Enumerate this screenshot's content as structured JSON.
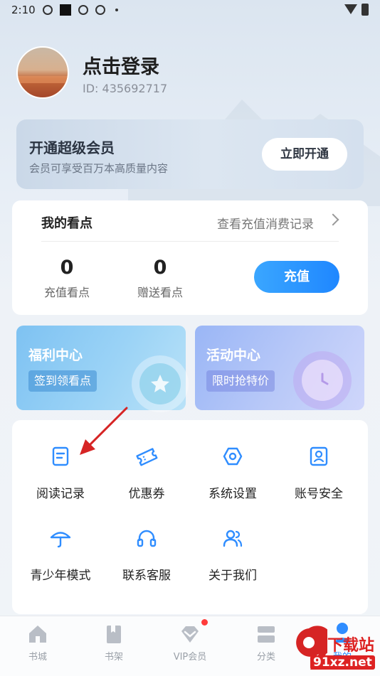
{
  "status_bar": {
    "time": "2:10"
  },
  "profile": {
    "login_text": "点击登录",
    "user_id": "ID: 435692717"
  },
  "vip_card": {
    "title": "开通超级会员",
    "subtitle": "会员可享受百万本高质量内容",
    "button": "立即开通"
  },
  "points": {
    "title": "我的看点",
    "history_link": "查看充值消费记录",
    "recharge_points": {
      "value": "0",
      "label": "充值看点"
    },
    "gift_points": {
      "value": "0",
      "label": "赠送看点"
    },
    "recharge_button": "充值"
  },
  "promos": [
    {
      "title": "福利中心",
      "pill": "签到领看点"
    },
    {
      "title": "活动中心",
      "pill": "限时抢特价"
    }
  ],
  "menu": [
    {
      "label": "阅读记录",
      "icon": "reading-record-icon"
    },
    {
      "label": "优惠券",
      "icon": "coupon-icon"
    },
    {
      "label": "系统设置",
      "icon": "settings-icon"
    },
    {
      "label": "账号安全",
      "icon": "account-security-icon"
    },
    {
      "label": "青少年模式",
      "icon": "umbrella-icon"
    },
    {
      "label": "联系客服",
      "icon": "headset-icon"
    },
    {
      "label": "关于我们",
      "icon": "users-icon"
    }
  ],
  "bottom_nav": [
    {
      "label": "书城",
      "icon": "home-icon"
    },
    {
      "label": "书架",
      "icon": "bookshelf-icon"
    },
    {
      "label": "VIP会员",
      "icon": "diamond-icon"
    },
    {
      "label": "分类",
      "icon": "category-icon"
    },
    {
      "label": "我的",
      "icon": "profile-icon"
    }
  ],
  "watermark": {
    "text": "下载站",
    "url": "91xz.net"
  },
  "colors": {
    "accent": "#2f8dff",
    "recharge": "#1f87ff",
    "badge": "#ff3b3b"
  }
}
